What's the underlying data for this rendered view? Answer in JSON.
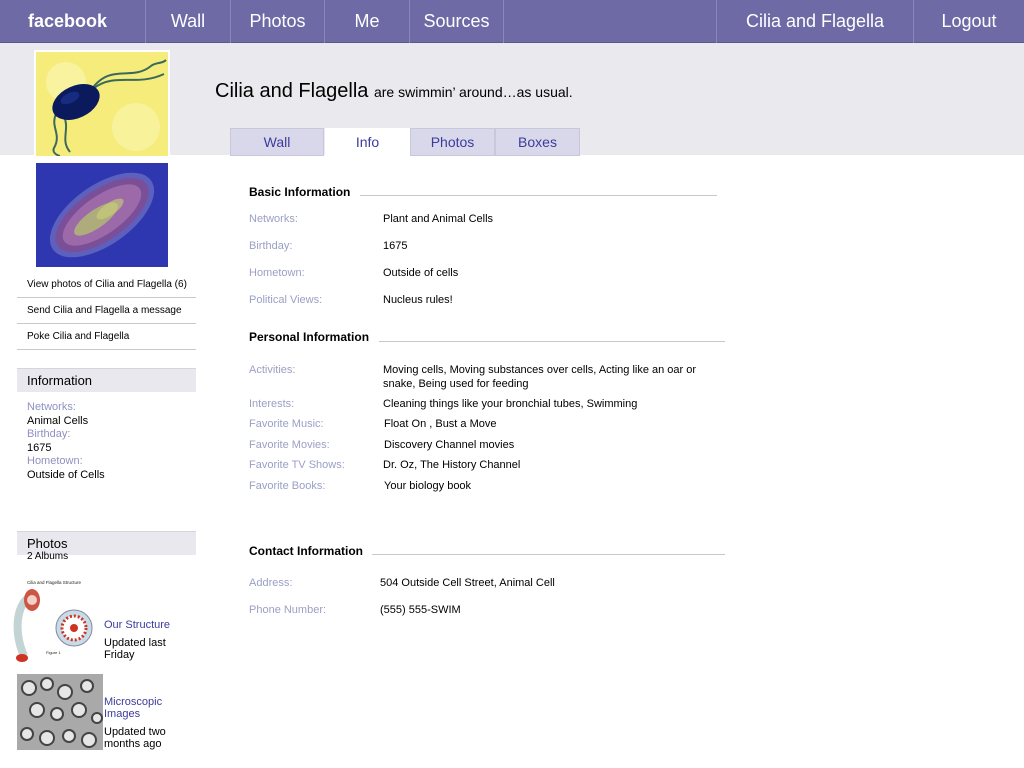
{
  "nav": {
    "brand": "facebook",
    "wall": "Wall",
    "photos": "Photos",
    "me": "Me",
    "sources": "Sources",
    "user": "Cilia and Flagella",
    "logout": "Logout"
  },
  "profile": {
    "name": "Cilia and Flagella",
    "status": "are swimmin’ around…as usual."
  },
  "tabs": [
    {
      "label": "Wall"
    },
    {
      "label": "Info"
    },
    {
      "label": "Photos"
    },
    {
      "label": "Boxes"
    }
  ],
  "sidebar": {
    "links": [
      "View photos of Cilia and Flagella (6)",
      "Send Cilia and Flagella a message",
      "Poke Cilia and Flagella"
    ],
    "info_heading": "Information",
    "info": {
      "networks_label": "Networks:",
      "networks_value": "Animal Cells",
      "birthday_label": "Birthday:",
      "birthday_value": "1675",
      "hometown_label": "Hometown:",
      "hometown_value": "Outside of Cells"
    },
    "photos_heading": "Photos",
    "albums_count": "2 Albums",
    "albums": [
      {
        "title": "Our Structure",
        "updated": "Updated last Friday"
      },
      {
        "title": "Microscopic Images",
        "updated": "Updated two months ago"
      }
    ]
  },
  "basic": {
    "title": "Basic Information",
    "rows": [
      {
        "label": "Networks:",
        "value": "Plant and Animal Cells"
      },
      {
        "label": "Birthday:",
        "value": "1675"
      },
      {
        "label": "Hometown:",
        "value": "Outside of cells"
      },
      {
        "label": "Political Views:",
        "value": "Nucleus rules!"
      }
    ]
  },
  "personal": {
    "title": "Personal Information",
    "rows": [
      {
        "label": "Activities:",
        "value": "Moving cells, Moving  substances over cells, Acting like an oar  or snake, Being used for  feeding"
      },
      {
        "label": "Interests:",
        "value": "Cleaning things like your bronchial tubes, Swimming"
      },
      {
        "label": "Favorite Music:",
        "value": "Float On , Bust a Move"
      },
      {
        "label": "Favorite Movies:",
        "value": "Discovery Channel movies"
      },
      {
        "label": "Favorite TV Shows:",
        "value": "Dr. Oz, The History Channel"
      },
      {
        "label": "Favorite Books:",
        "value": "Your biology book"
      }
    ]
  },
  "contact": {
    "title": "Contact Information",
    "rows": [
      {
        "label": "Address:",
        "value": "504 Outside Cell Street, Animal Cell"
      },
      {
        "label": "Phone Number:",
        "value": "(555) 555-SWIM"
      }
    ]
  },
  "figure_labels": {
    "diagram_title": "Cilia and Flagella Structure",
    "figure": "Figure 1"
  },
  "colors": {
    "topbar": "#6d6aa6",
    "link": "#3b3b9e",
    "label": "#9aa0c4",
    "header_band": "#e9e9ee"
  }
}
